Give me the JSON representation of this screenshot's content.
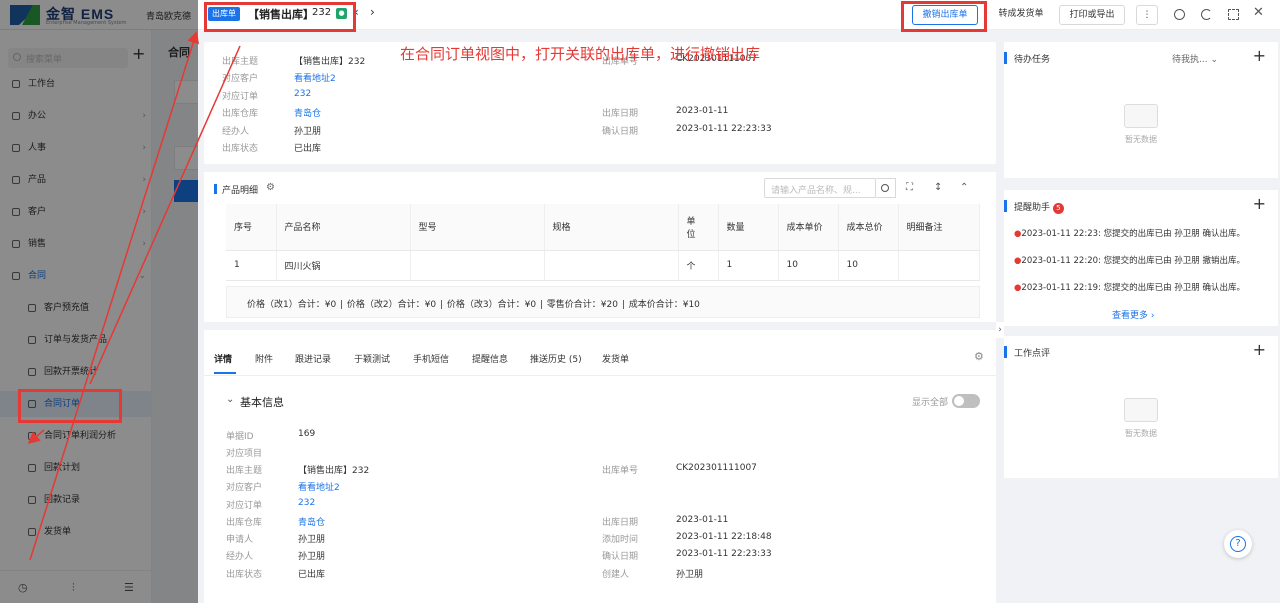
{
  "app": {
    "brand": "金智 EMS",
    "brand_sub": "Enterprise Management System",
    "company": "青岛欧克德"
  },
  "sidebar": {
    "search_placeholder": "搜索菜单",
    "items": [
      {
        "label": "工作台"
      },
      {
        "label": "办公"
      },
      {
        "label": "人事"
      },
      {
        "label": "产品"
      },
      {
        "label": "客户"
      },
      {
        "label": "销售"
      },
      {
        "label": "合同"
      }
    ],
    "sub_items": [
      {
        "label": "客户预充值"
      },
      {
        "label": "订单与发货产品"
      },
      {
        "label": "回款开票统计"
      },
      {
        "label": "合同订单"
      },
      {
        "label": "合同订单利润分析"
      },
      {
        "label": "回款计划"
      },
      {
        "label": "回款记录"
      },
      {
        "label": "发货单"
      }
    ]
  },
  "bg_title": "合同",
  "drawer": {
    "tag": "出库单",
    "title": "【销售出库】",
    "title_num": "232",
    "buttons": {
      "cancel": "撤销出库单",
      "convert": "转成发货单",
      "print": "打印或导出",
      "more": "⋮"
    }
  },
  "annotation": "在合同订单视图中，打开关联的出库单，进行撤销出库",
  "info": {
    "subject_label": "出库主题",
    "subject": "【销售出库】232",
    "customer_label": "对应客户",
    "customer": "看看地址2",
    "order_label": "对应订单",
    "order": "232",
    "warehouse_label": "出库仓库",
    "warehouse": "青岛仓",
    "handler_label": "经办人",
    "handler": "孙卫朋",
    "status_label": "出库状态",
    "status": "已出库",
    "no_label": "出库单号",
    "no": "CK202301111007",
    "date_label": "出库日期",
    "date": "2023-01-11",
    "confirm_label": "确认日期",
    "confirm": "2023-01-11 22:23:33"
  },
  "product": {
    "title": "产品明细",
    "search_placeholder": "请输入产品名称、规...",
    "headers": [
      "序号",
      "产品名称",
      "型号",
      "规格",
      "单位",
      "数量",
      "成本单价",
      "成本总价",
      "明细备注"
    ],
    "rows": [
      [
        "1",
        "四川火锅",
        "",
        "",
        "个",
        "1",
        "10",
        "10",
        ""
      ]
    ],
    "summary": "价格（改1）合计：¥0 | 价格（改2）合计：¥0 | 价格（改3）合计：¥0 | 零售价合计：¥20 | 成本价合计：¥10"
  },
  "tabs": [
    "详情",
    "附件",
    "跟进记录",
    "于颖测试",
    "手机短信",
    "提醒信息",
    "推送历史 (5)",
    "发货单"
  ],
  "detail": {
    "section": "基本信息",
    "show_all": "显示全部",
    "id_label": "单据ID",
    "id": "169",
    "project_label": "对应项目",
    "subject_label": "出库主题",
    "subject": "【销售出库】232",
    "customer_label": "对应客户",
    "customer": "看看地址2",
    "order_label": "对应订单",
    "order": "232",
    "warehouse_label": "出库仓库",
    "warehouse": "青岛仓",
    "applicant_label": "申请人",
    "applicant": "孙卫朋",
    "handler_label": "经办人",
    "handler": "孙卫朋",
    "status_label": "出库状态",
    "status": "已出库",
    "no_label": "出库单号",
    "no": "CK202301111007",
    "date_label": "出库日期",
    "date": "2023-01-11",
    "added_label": "添加时间",
    "added": "2023-01-11 22:18:48",
    "confirm_label": "确认日期",
    "confirm": "2023-01-11 22:23:33",
    "creator_label": "创建人",
    "creator": "孙卫朋"
  },
  "todo": {
    "title": "待办任务",
    "filter": "待我执...",
    "empty": "暂无数据"
  },
  "reminder": {
    "title": "提醒助手",
    "badge": "5",
    "items": [
      "2023-01-11 22:23: 您提交的出库已由 孙卫朋 确认出库。",
      "2023-01-11 22:20: 您提交的出库已由 孙卫朋 撤销出库。",
      "2023-01-11 22:19: 您提交的出库已由 孙卫朋 确认出库。"
    ],
    "more": "查看更多"
  },
  "review": {
    "title": "工作点评",
    "empty": "暂无数据"
  },
  "colors": {
    "accent": "#1a73e8",
    "annotation": "#e53935"
  }
}
